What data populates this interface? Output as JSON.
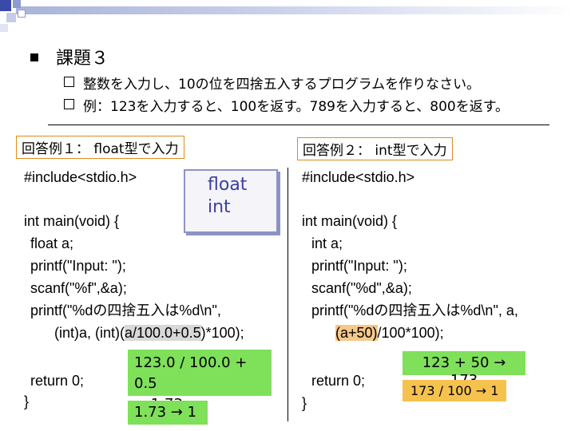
{
  "title": "課題３",
  "bullets": [
    "整数を入力し、10の位を四捨五入するプログラムを作りなさい。",
    "例：123を入力すると、100を返す。789を入力すると、800を返す。"
  ],
  "left": {
    "label": "回答例１： float型で入力",
    "include": "#include<stdio.h>",
    "main": "int main(void) {",
    "l1": "float a;",
    "l2": "printf(\"Input: \");",
    "l3": "scanf(\"%f\",&a);",
    "l4": "printf(\"%dの四捨五入は%d\\n\",",
    "l5a": "(int)a, (int)(",
    "l5b": "a/100.0+0.5",
    "l5c": ")*100);",
    "ret": "return 0;",
    "close": "}"
  },
  "callout": {
    "line1": "float",
    "line2": "int"
  },
  "green1": {
    "line1": "123.0 / 100.0 + 0.5",
    "line2": "→ 1.73"
  },
  "green2": "1.73 → 1",
  "right": {
    "label": "回答例２： int型で入力",
    "include": "#include<stdio.h>",
    "main": "int main(void) {",
    "l1": "int a;",
    "l2": "printf(\"Input: \");",
    "l3": "scanf(\"%d\",&a);",
    "l4": "printf(\"%dの四捨五入は%d\\n\", a,",
    "l5a": "(a+50)",
    "l5b": "/100*100);",
    "ret": "return 0;",
    "close": "}"
  },
  "green3": "123 + 50 → 173",
  "orange": "173 / 100 → 1"
}
